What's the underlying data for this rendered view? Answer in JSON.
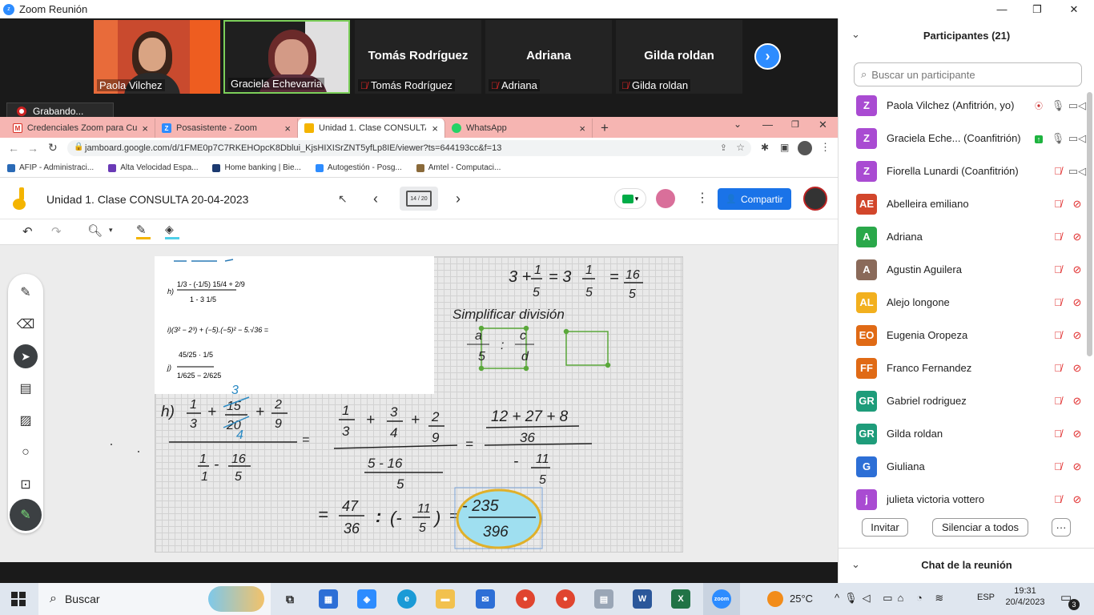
{
  "window": {
    "title": "Zoom Reunión",
    "minimize": "—",
    "maximize": "❐",
    "close": "✕"
  },
  "video": {
    "tiles": [
      {
        "name": "Paola Vilchez",
        "muted": false,
        "video": true
      },
      {
        "name": "Graciela Echevarria",
        "muted": false,
        "video": true
      },
      {
        "name": "Tomás Rodríguez",
        "muted": true,
        "video": false
      },
      {
        "name": "Adriana",
        "muted": true,
        "video": false
      },
      {
        "name": "Gilda roldan",
        "muted": true,
        "video": false
      }
    ],
    "recording": "Grabando..."
  },
  "browser": {
    "tabs": [
      {
        "label": "Credenciales Zoom para Curso d",
        "icon": "gmail-icon"
      },
      {
        "label": "Posasistente - Zoom",
        "icon": "zoom-icon"
      },
      {
        "label": "Unidad 1. Clase CONSULTA 20-0",
        "icon": "jamboard-icon"
      },
      {
        "label": "WhatsApp",
        "icon": "whatsapp-icon"
      }
    ],
    "new_tab": "+",
    "url": "jamboard.google.com/d/1FME0p7C7RKEHOpcK8Dblui_KjsHIXISrZNT5yfLp8IE/viewer?ts=644193cc&f=13",
    "bookmarks": [
      "AFIP - Administraci...",
      "Alta Velocidad Espa...",
      "Home banking | Bie...",
      "Autogestión - Posg...",
      "Amtel - Computaci..."
    ]
  },
  "jamboard": {
    "title": "Unidad 1. Clase CONSULTA 20-04-2023",
    "frame_indicator": "14 / 20",
    "share_label": "Compartir",
    "handwriting": {
      "top_right_eq": [
        "3 +",
        "1",
        "5",
        "= 3",
        "1",
        "5",
        "=",
        "16",
        "5"
      ],
      "simplify_note": "Simplificar división",
      "h_label": "h)",
      "result_num": "- 235",
      "result_den": "396",
      "big_frac_terms": [
        "1",
        "3",
        "+",
        "15",
        "20",
        "+",
        "2",
        "9",
        "1",
        "1",
        "-",
        "16",
        "5"
      ],
      "mid_frac_terms": [
        "1",
        "3",
        "+",
        "3",
        "4",
        "+",
        "2",
        "9",
        "5 - 16",
        "5"
      ],
      "right_frac_terms": [
        "12 + 27 + 8",
        "36",
        "-",
        "11",
        "5"
      ],
      "bottom_eq": [
        "=",
        "47",
        "36",
        ":",
        "(-",
        "11",
        "5",
        ")",
        "="
      ],
      "blue_marks": [
        "3",
        "4"
      ]
    },
    "printed": {
      "h_label": "h)",
      "h_num": "1/3 - (-1/5) 15/4 + 2/9",
      "h_den": "1 - 3 1/5",
      "i_expr": "i)(3² − 2³) + (−5).(−5)² − 5.√36 =",
      "j_label": "j)",
      "j_num": "45/25 · 1/5",
      "j_den": "1/625 − 2/625"
    }
  },
  "participants": {
    "header": "Participantes (21)",
    "search_placeholder": "Buscar un participante",
    "list": [
      {
        "initials": "Z",
        "name": "Paola Vilchez (Anfitrión, yo)",
        "color": "#a94bd2",
        "mic": "on",
        "cam": "on"
      },
      {
        "initials": "Z",
        "name": "Graciela Eche...  (Coanfitrión)",
        "color": "#a94bd2",
        "mic": "on",
        "cam": "on"
      },
      {
        "initials": "Z",
        "name": "Fiorella Lunardi (Coanfitrión)",
        "color": "#a94bd2",
        "mic": "off",
        "cam": "on"
      },
      {
        "initials": "AE",
        "name": "Abelleira emiliano",
        "color": "#d2462b",
        "mic": "off",
        "cam": "off"
      },
      {
        "initials": "A",
        "name": "Adriana",
        "color": "#2aa84a",
        "mic": "off",
        "cam": "off"
      },
      {
        "initials": "A",
        "name": "Agustin Aguilera",
        "color": "#8a6a5a",
        "mic": "off",
        "cam": "off"
      },
      {
        "initials": "AL",
        "name": "Alejo longone",
        "color": "#f2b01e",
        "mic": "off",
        "cam": "off"
      },
      {
        "initials": "EO",
        "name": "Eugenia Oropeza",
        "color": "#e06a15",
        "mic": "off",
        "cam": "off"
      },
      {
        "initials": "FF",
        "name": "Franco Fernandez",
        "color": "#e06a15",
        "mic": "off",
        "cam": "off"
      },
      {
        "initials": "GR",
        "name": "Gabriel rodriguez",
        "color": "#1e9c7a",
        "mic": "off",
        "cam": "off"
      },
      {
        "initials": "GR",
        "name": "Gilda roldan",
        "color": "#1e9c7a",
        "mic": "off",
        "cam": "off"
      },
      {
        "initials": "G",
        "name": "Giuliana",
        "color": "#2d6fd6",
        "mic": "off",
        "cam": "off"
      },
      {
        "initials": "j",
        "name": "julieta victoria vottero",
        "color": "#a94bd2",
        "mic": "off",
        "cam": "off"
      }
    ],
    "invite": "Invitar",
    "mute_all": "Silenciar a todos",
    "more": "···",
    "chat_header": "Chat de la reunión"
  },
  "taskbar": {
    "search": "Buscar",
    "temp": "25°C",
    "lang": "ESP",
    "time": "19:31",
    "date": "20/4/2023",
    "notif": "3"
  }
}
